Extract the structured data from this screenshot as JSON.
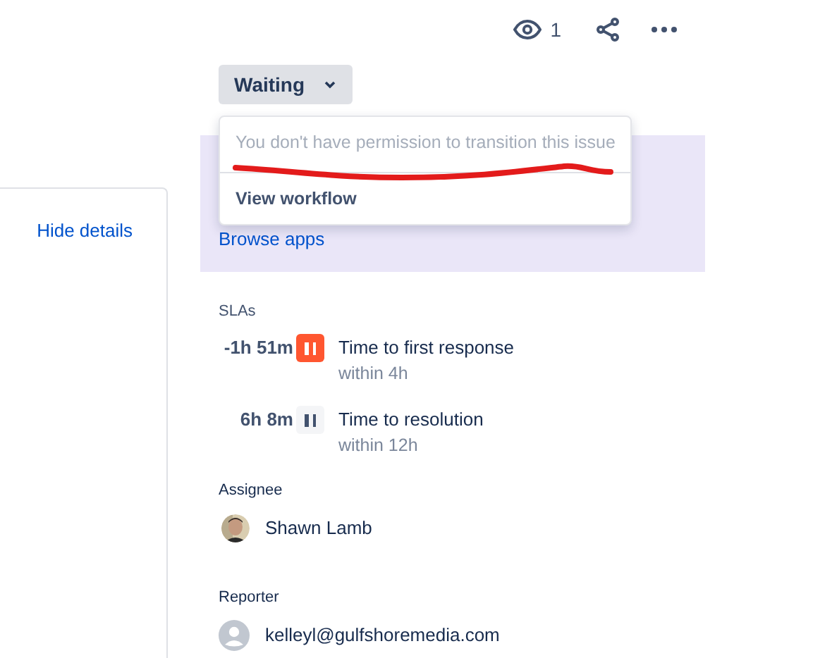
{
  "toolbar": {
    "watchers": "1"
  },
  "status_button": {
    "label": "Waiting",
    "expanded": true
  },
  "status_menu": {
    "message": "You don't have permission to transition this issue",
    "items": [
      "View workflow"
    ]
  },
  "apps_panel": {
    "link": "Browse apps"
  },
  "side_panel": {
    "link": "Hide details"
  },
  "slas": {
    "heading": "SLAs",
    "items": [
      {
        "time": "-1h 51m",
        "breached": true,
        "name": "Time to first response",
        "goal": "within 4h"
      },
      {
        "time": "6h 8m",
        "breached": false,
        "name": "Time to resolution",
        "goal": "within 12h"
      }
    ]
  },
  "assignee": {
    "label": "Assignee",
    "name": "Shawn Lamb",
    "kind": "picture"
  },
  "reporter": {
    "label": "Reporter",
    "name": "kelleyl@gulfshoremedia.com",
    "kind": "default"
  },
  "annotation": {
    "kind": "underline"
  }
}
